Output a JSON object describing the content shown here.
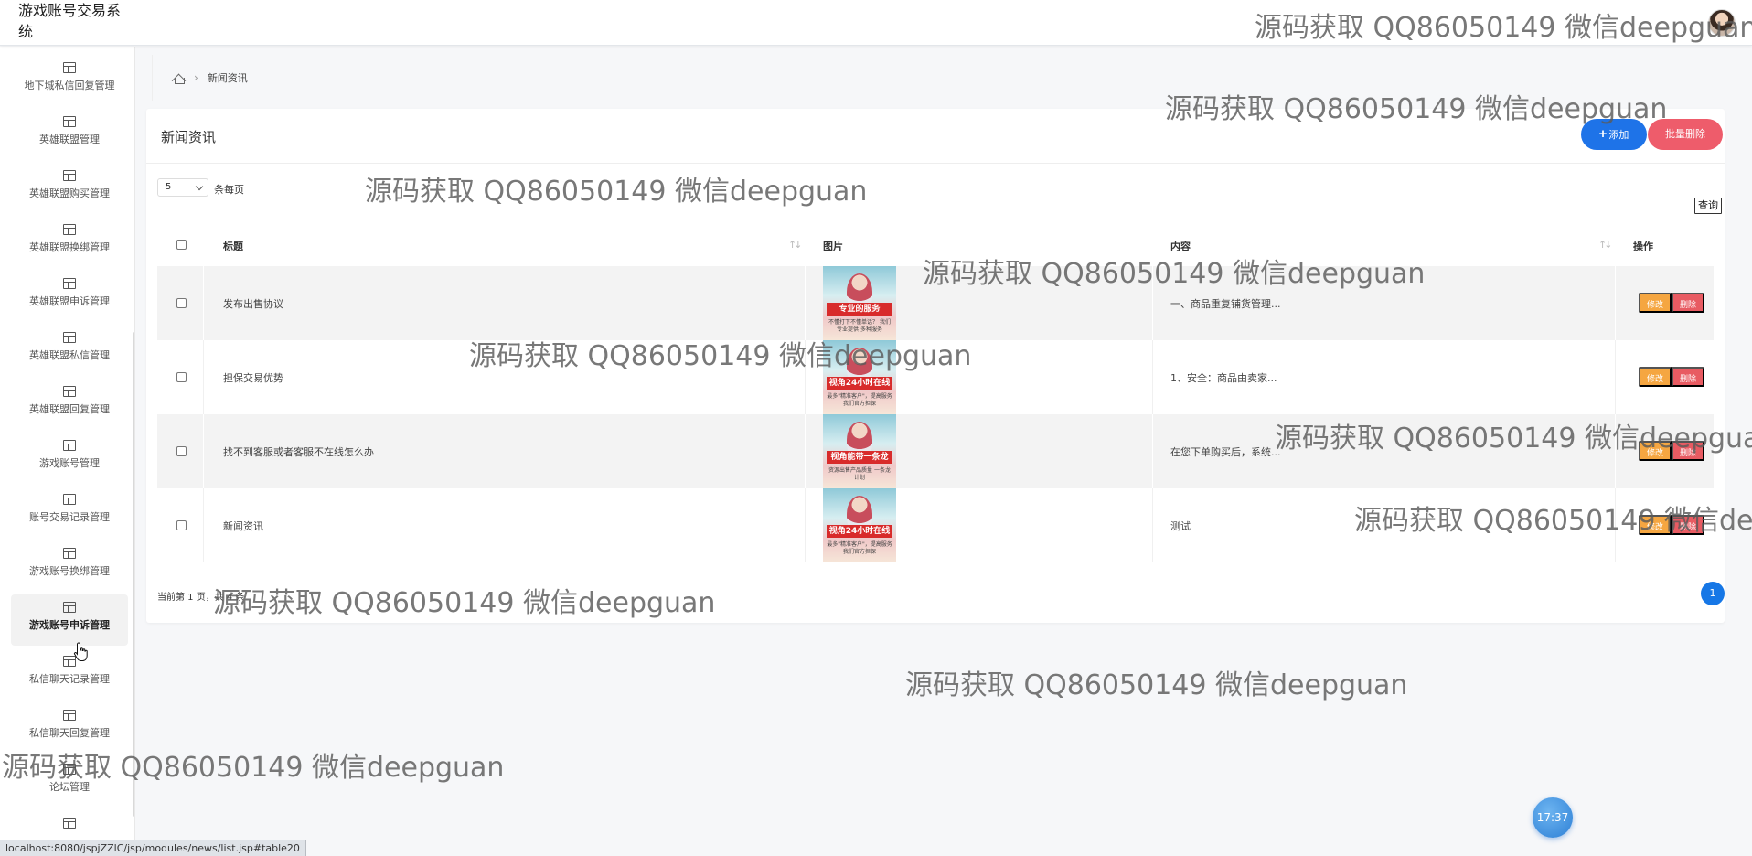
{
  "app": {
    "title": "游戏账号交易系统"
  },
  "sidebar": {
    "items": [
      {
        "label": "地下城私信回复管理"
      },
      {
        "label": "英雄联盟管理"
      },
      {
        "label": "英雄联盟购买管理"
      },
      {
        "label": "英雄联盟换绑管理"
      },
      {
        "label": "英雄联盟申诉管理"
      },
      {
        "label": "英雄联盟私信管理"
      },
      {
        "label": "英雄联盟回复管理"
      },
      {
        "label": "游戏账号管理"
      },
      {
        "label": "账号交易记录管理"
      },
      {
        "label": "游戏账号换绑管理"
      },
      {
        "label": "游戏账号申诉管理"
      },
      {
        "label": "私信聊天记录管理"
      },
      {
        "label": "私信聊天回复管理"
      },
      {
        "label": "论坛管理"
      },
      {
        "label": ""
      }
    ],
    "active_index": 10
  },
  "breadcrumb": {
    "current": "新闻资讯"
  },
  "panel": {
    "title": "新闻资讯",
    "add_label": "添加",
    "batch_delete_label": "批量删除",
    "page_size": "5",
    "page_size_label": "条每页",
    "search_label": "查询"
  },
  "table": {
    "headers": {
      "title": "标题",
      "image": "图片",
      "content": "内容",
      "actions": "操作"
    },
    "rows": [
      {
        "title": "发布出售协议",
        "content": "一、商品重复铺货管理...",
        "image_banner": "专业的服务",
        "image_caption": "不懂打下不懂单话？ 我们专业提供 多种服务"
      },
      {
        "title": "担保交易优势",
        "content": "1、安全：商品由卖家...",
        "image_banner": "视角24小时在线",
        "image_caption": "最多\"精准客户\"，提高服务 我们官方担保"
      },
      {
        "title": "找不到客服或者客服不在线怎么办",
        "content": "在您下单购买后，系统...",
        "image_banner": "视角能带一条龙",
        "image_caption": "资源出售产品质量 一条龙计划"
      },
      {
        "title": "新闻资讯",
        "content": "测试",
        "image_banner": "视角24小时在线",
        "image_caption": "最多\"精准客户\"，提高服务 我们官方担保"
      }
    ],
    "edit_label": "修改",
    "delete_label": "删除"
  },
  "pagination": {
    "summary": "当前第 1 页，共 4 条",
    "current_page": "1"
  },
  "clock": {
    "time": "17:37"
  },
  "statusbar": {
    "url": "localhost:8080/jspjZZlC/jsp/modules/news/list.jsp#table20"
  },
  "watermark": {
    "text": "源码获取 QQ86050149 微信deepguan"
  }
}
